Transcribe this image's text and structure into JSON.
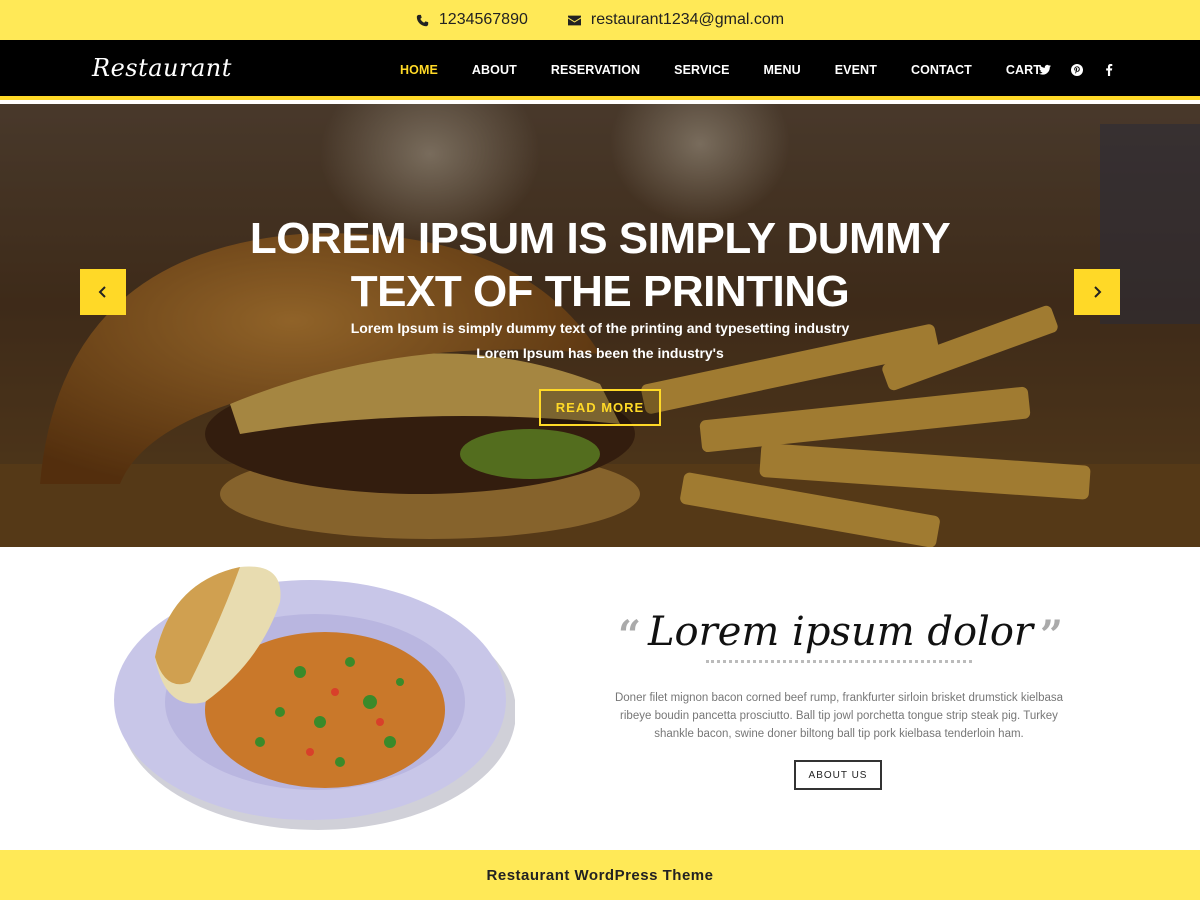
{
  "topbar": {
    "phone": "1234567890",
    "email": "restaurant1234@gmal.com"
  },
  "nav": {
    "logo": "Restaurant",
    "items": [
      {
        "label": "HOME",
        "active": true
      },
      {
        "label": "ABOUT"
      },
      {
        "label": "RESERVATION"
      },
      {
        "label": "SERVICE"
      },
      {
        "label": "MENU"
      },
      {
        "label": "EVENT"
      },
      {
        "label": "CONTACT"
      },
      {
        "label": "CART"
      }
    ],
    "social": [
      "twitter-icon",
      "pinterest-icon",
      "facebook-icon"
    ]
  },
  "hero": {
    "title_line1": "LOREM IPSUM IS SIMPLY DUMMY",
    "title_line2": "TEXT OF THE PRINTING",
    "subtitle_line1": "Lorem Ipsum is simply dummy text of the printing and typesetting industry",
    "subtitle_line2": "Lorem Ipsum has been the industry's",
    "button_label": "READ MORE"
  },
  "about": {
    "heading": "Lorem ipsum dolor",
    "body": "Doner filet mignon bacon corned beef rump, frankfurter sirloin brisket drumstick kielbasa ribeye boudin pancetta prosciutto. Ball tip jowl porchetta tongue strip steak pig. Turkey shankle bacon, swine doner biltong ball tip pork kielbasa tenderloin ham.",
    "button_label": "ABOUT US"
  },
  "footer": {
    "text": "Restaurant WordPress Theme"
  },
  "colors": {
    "accent": "#ffd927",
    "topbar": "#ffe957",
    "nav_bg": "#000000"
  }
}
